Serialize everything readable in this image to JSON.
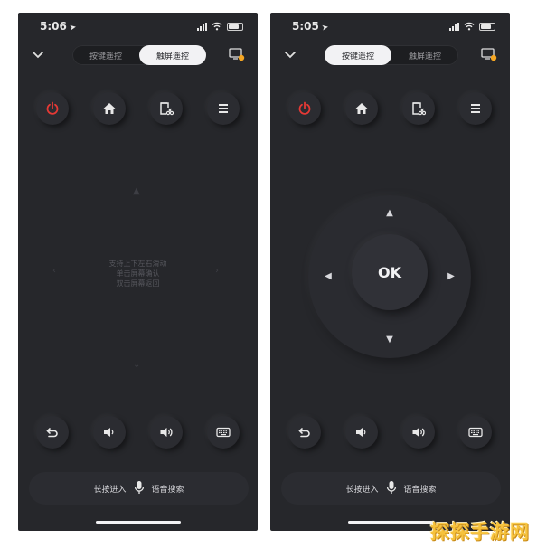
{
  "screens": [
    {
      "status": {
        "time": "5:06"
      },
      "tabs": {
        "keys": "按键遥控",
        "touch": "触屏遥控",
        "active": "touch"
      },
      "touch_hint": [
        "支持上下左右滑动",
        "单击屏幕确认",
        "双击屏幕返回"
      ],
      "voice": {
        "left": "长按进入",
        "right": "语音搜索"
      }
    },
    {
      "status": {
        "time": "5:05"
      },
      "tabs": {
        "keys": "按键遥控",
        "touch": "触屏遥控",
        "active": "keys"
      },
      "dpad": {
        "ok_label": "OK"
      },
      "voice": {
        "left": "长按进入",
        "right": "语音搜索"
      }
    }
  ],
  "icons": {
    "top_row": [
      "power-icon",
      "home-icon",
      "screenshot-cut-icon",
      "menu-icon"
    ],
    "bottom_row": [
      "back-icon",
      "volume-down-icon",
      "volume-up-icon",
      "keyboard-icon"
    ]
  },
  "colors": {
    "background": "#26272b",
    "power": "#e53935",
    "active_tab": "#f2f2f4",
    "badge": "#f5a623"
  },
  "watermark": "探探手游网"
}
